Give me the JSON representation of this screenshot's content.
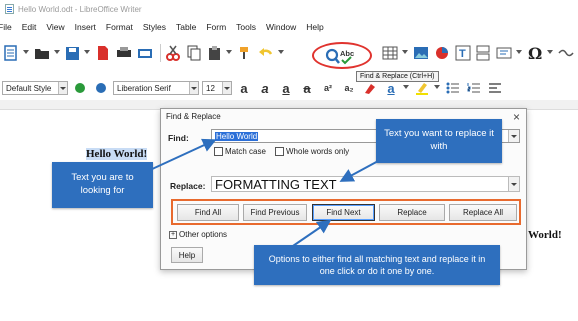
{
  "window": {
    "title": "Hello World.odt - LibreOffice Writer"
  },
  "menu": [
    "File",
    "Edit",
    "View",
    "Insert",
    "Format",
    "Styles",
    "Table",
    "Form",
    "Tools",
    "Window",
    "Help"
  ],
  "toolbar": {
    "paragraph_style": "Default Style",
    "font_name": "Liberation Serif",
    "font_size": "12",
    "tooltip": "Find & Replace (Ctrl+H)"
  },
  "document": {
    "word_left": "Hello World!",
    "word_right": "World!"
  },
  "dialog": {
    "title": "Find & Replace",
    "find_label": "Find:",
    "find_value": "Hello World",
    "match_case": "Match case",
    "whole_words": "Whole words only",
    "replace_label": "Replace:",
    "replace_value": "FORMATTING TEXT",
    "buttons": [
      "Find All",
      "Find Previous",
      "Find Next",
      "Replace",
      "Replace All"
    ],
    "other_options": "Other options",
    "help": "Help"
  },
  "callouts": {
    "replace_with": "Text you want to replace it with",
    "looking_for": "Text you are to looking for",
    "options": "Options to either find all matching text and replace it in one click or do it one by one."
  },
  "colors": {
    "callout": "#2e6fbe",
    "highlight_ring": "#e0332e",
    "button_frame": "#e86a2e",
    "selection": "#2b6fd8"
  }
}
